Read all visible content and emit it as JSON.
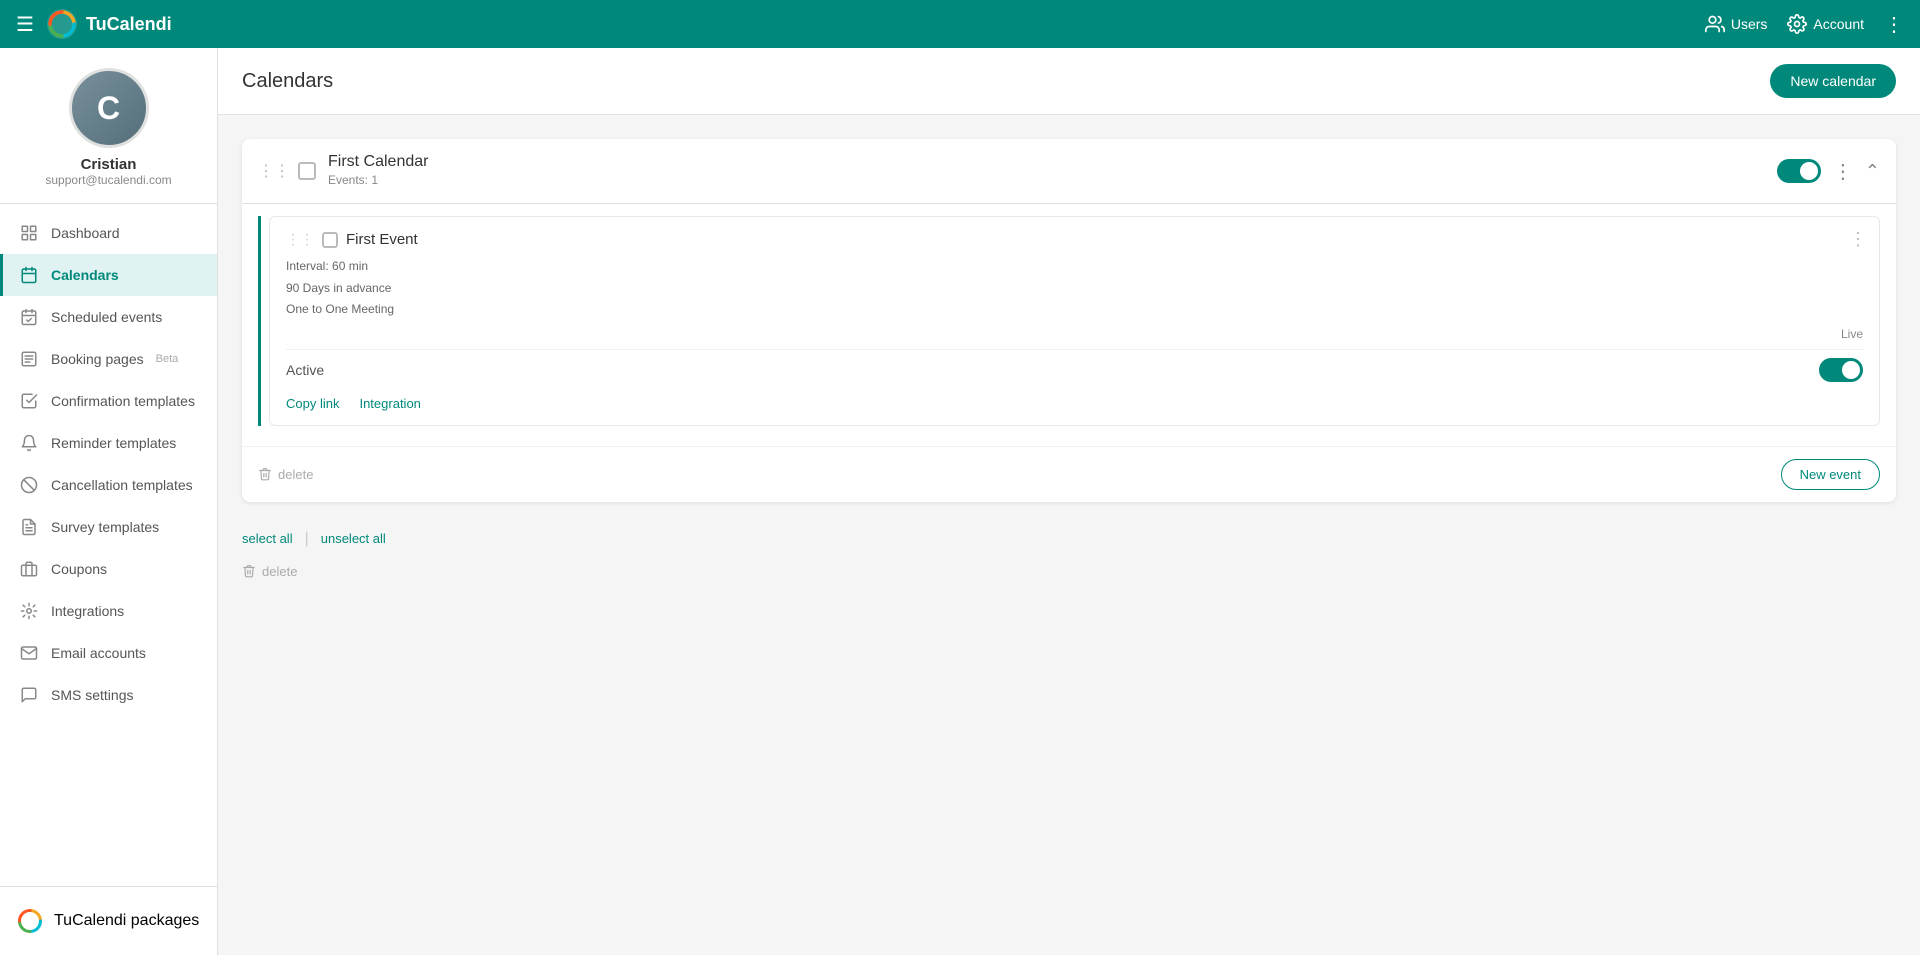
{
  "topbar": {
    "app_name": "TuCalendi",
    "users_label": "Users",
    "account_label": "Account"
  },
  "sidebar": {
    "user": {
      "name": "Cristian",
      "email": "support@tucalendi.com"
    },
    "nav_items": [
      {
        "id": "dashboard",
        "label": "Dashboard",
        "icon": "grid-icon"
      },
      {
        "id": "calendars",
        "label": "Calendars",
        "icon": "calendar-icon",
        "active": true
      },
      {
        "id": "scheduled-events",
        "label": "Scheduled events",
        "icon": "clock-icon"
      },
      {
        "id": "booking-pages",
        "label": "Booking pages",
        "icon": "page-icon",
        "sublabel": "Beta"
      },
      {
        "id": "confirmation-templates",
        "label": "Confirmation templates",
        "icon": "check-template-icon"
      },
      {
        "id": "reminder-templates",
        "label": "Reminder templates",
        "icon": "bell-icon"
      },
      {
        "id": "cancellation-templates",
        "label": "Cancellation templates",
        "icon": "cancel-icon"
      },
      {
        "id": "survey-templates",
        "label": "Survey templates",
        "icon": "survey-icon"
      },
      {
        "id": "coupons",
        "label": "Coupons",
        "icon": "coupon-icon"
      },
      {
        "id": "integrations",
        "label": "Integrations",
        "icon": "integrations-icon"
      },
      {
        "id": "email-accounts",
        "label": "Email accounts",
        "icon": "email-icon"
      },
      {
        "id": "sms-settings",
        "label": "SMS settings",
        "icon": "sms-icon"
      }
    ],
    "footer": {
      "label": "TuCalendi packages"
    }
  },
  "main": {
    "title": "Calendars",
    "new_calendar_btn": "New calendar",
    "calendar": {
      "name": "First Calendar",
      "events_count_label": "Events: 1",
      "enabled": true,
      "event": {
        "name": "First Event",
        "interval": "Interval: 60 min",
        "advance": "90 Days in advance",
        "meeting_type": "One to One Meeting",
        "status": "Live",
        "active_label": "Active",
        "active": true,
        "copy_link_label": "Copy link",
        "integration_label": "Integration"
      },
      "delete_label": "delete",
      "new_event_btn": "New event"
    },
    "select_all_label": "select all",
    "unselect_all_label": "unselect all",
    "bottom_delete_label": "delete"
  }
}
